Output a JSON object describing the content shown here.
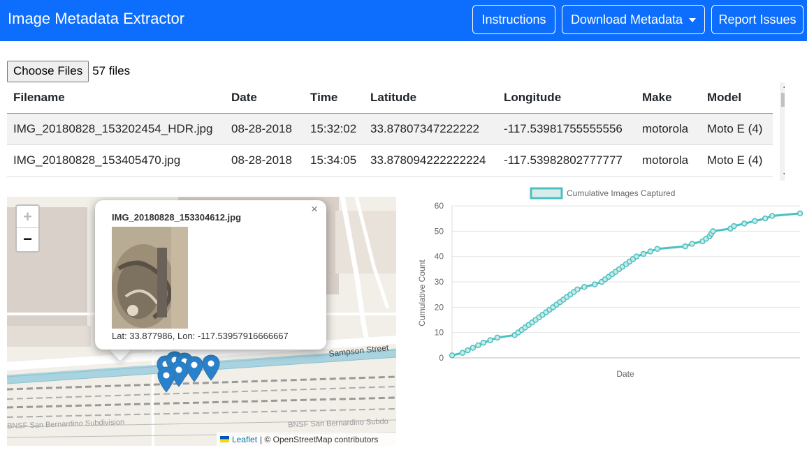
{
  "app": {
    "title": "Image Metadata Extractor",
    "nav": {
      "instructions": "Instructions",
      "download": "Download Metadata",
      "report": "Report Issues"
    },
    "accent": "#0d6efd"
  },
  "file_input": {
    "button_label": "Choose Files",
    "status": "57 files"
  },
  "table": {
    "headers": [
      "Filename",
      "Date",
      "Time",
      "Latitude",
      "Longitude",
      "Make",
      "Model"
    ],
    "rows": [
      [
        "IMG_20180828_153202454_HDR.jpg",
        "08-28-2018",
        "15:32:02",
        "33.87807347222222",
        "-117.53981755555556",
        "motorola",
        "Moto E (4)"
      ],
      [
        "IMG_20180828_153405470.jpg",
        "08-28-2018",
        "15:34:05",
        "33.878094222222224",
        "-117.53982802777777",
        "motorola",
        "Moto E (4)"
      ]
    ]
  },
  "map": {
    "zoom_in": "+",
    "zoom_out": "−",
    "popup": {
      "close": "×",
      "title": "IMG_20180828_153304612.jpg",
      "coords": "Lat: 33.877986, Lon: -117.53957916666667"
    },
    "street_labels": [
      "Sampson Street",
      "BNSF San Bernardino Subdivision",
      "BNSF San Bernardino Subdo"
    ],
    "attribution": {
      "leaflet": "Leaflet",
      "rest": "| © OpenStreetMap contributors"
    },
    "marker_color": "#2a81cb"
  },
  "chart_data": {
    "type": "line",
    "legend": "Cumulative Images Captured",
    "xlabel": "Date",
    "ylabel": "Cumulative Count",
    "ylim": [
      0,
      60
    ],
    "yticks": [
      0,
      10,
      20,
      30,
      40,
      50,
      60
    ],
    "legend_position": "top",
    "grid": true,
    "color": "#4bc0c0",
    "series": [
      {
        "name": "Cumulative Images Captured",
        "x": [
          0.0,
          0.03,
          0.045,
          0.06,
          0.075,
          0.09,
          0.11,
          0.13,
          0.18,
          0.19,
          0.2,
          0.21,
          0.22,
          0.23,
          0.24,
          0.25,
          0.26,
          0.27,
          0.28,
          0.29,
          0.3,
          0.31,
          0.32,
          0.33,
          0.34,
          0.35,
          0.36,
          0.38,
          0.41,
          0.43,
          0.44,
          0.45,
          0.46,
          0.47,
          0.48,
          0.49,
          0.5,
          0.51,
          0.52,
          0.53,
          0.55,
          0.57,
          0.59,
          0.67,
          0.69,
          0.72,
          0.73,
          0.74,
          0.745,
          0.75,
          0.8,
          0.81,
          0.84,
          0.87,
          0.9,
          0.92,
          1.0
        ],
        "values": [
          1,
          2,
          3,
          4,
          5,
          6,
          7,
          8,
          9,
          10,
          11,
          12,
          13,
          14,
          15,
          16,
          17,
          18,
          19,
          20,
          21,
          22,
          23,
          24,
          25,
          26,
          27,
          28,
          29,
          30,
          31,
          32,
          33,
          34,
          35,
          36,
          37,
          38,
          39,
          40,
          41,
          42,
          43,
          44,
          45,
          46,
          47,
          48,
          49,
          50,
          51,
          52,
          53,
          54,
          55,
          56,
          57
        ]
      }
    ]
  }
}
